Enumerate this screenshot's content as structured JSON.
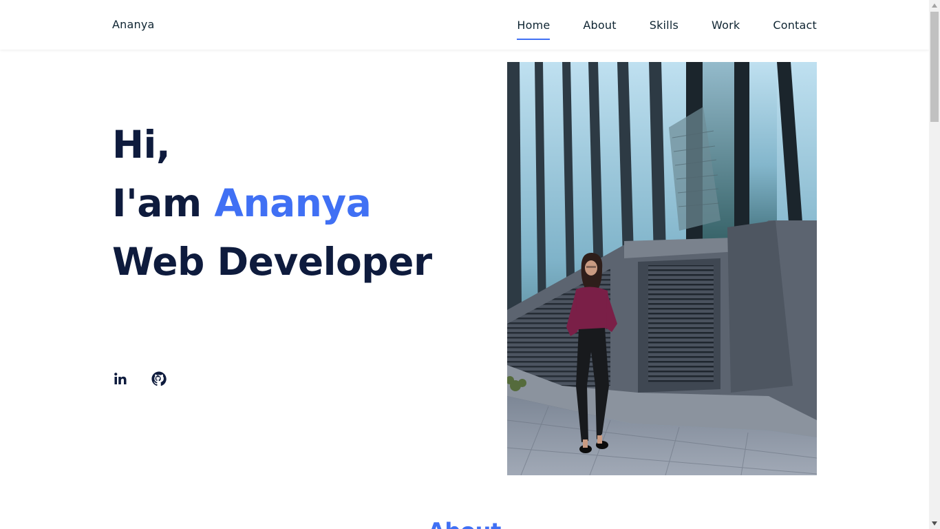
{
  "header": {
    "logo": "Ananya",
    "nav": [
      {
        "label": "Home",
        "active": true
      },
      {
        "label": "About",
        "active": false
      },
      {
        "label": "Skills",
        "active": false
      },
      {
        "label": "Work",
        "active": false
      },
      {
        "label": "Contact",
        "active": false
      }
    ]
  },
  "hero": {
    "line1": "Hi,",
    "line2_prefix": "I'am ",
    "line2_name": "Ananya",
    "line3": "Web Developer",
    "socials": [
      {
        "icon": "linkedin-icon"
      },
      {
        "icon": "github-icon"
      }
    ],
    "photo_icon": "portrait-photo"
  },
  "about": {
    "title": "About"
  },
  "colors": {
    "accent": "#4070f4",
    "heading": "#0e1b3d",
    "nav_text": "#0e2431"
  }
}
